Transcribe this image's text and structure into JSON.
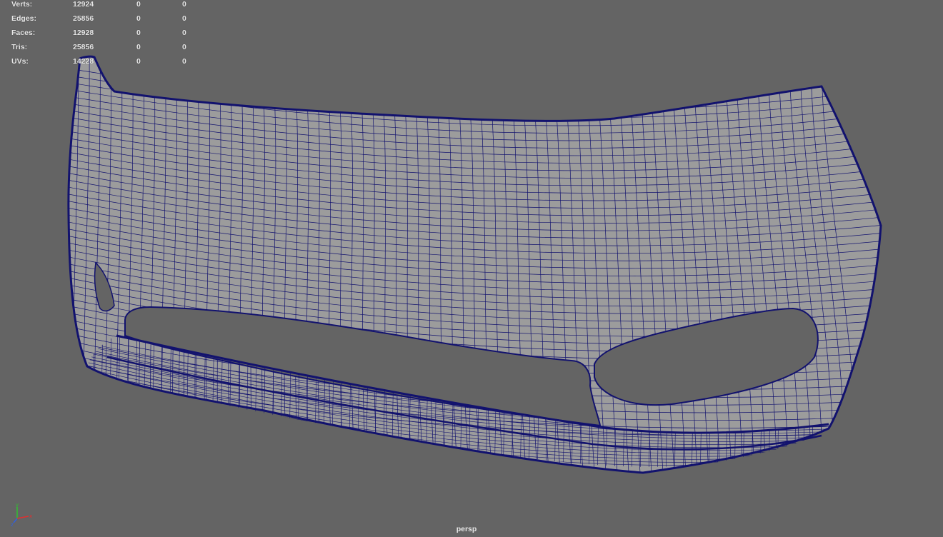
{
  "heads_up_display": {
    "rows": [
      {
        "label": "Verts:",
        "total": "12924",
        "selected": "0",
        "selected_component": "0"
      },
      {
        "label": "Edges:",
        "total": "25856",
        "selected": "0",
        "selected_component": "0"
      },
      {
        "label": "Faces:",
        "total": "12928",
        "selected": "0",
        "selected_component": "0"
      },
      {
        "label": "Tris:",
        "total": "25856",
        "selected": "0",
        "selected_component": "0"
      },
      {
        "label": "UVs:",
        "total": "14228",
        "selected": "0",
        "selected_component": "0"
      }
    ]
  },
  "viewport": {
    "camera_name": "persp",
    "background_color": "#646464",
    "mesh_fill_color": "#9c9c9c",
    "wireframe_color": "#12126e",
    "axis_icon": "xyz-axis-gizmo-icon",
    "axis_colors": {
      "x": "#e03030",
      "y": "#30c030",
      "z": "#3060e0"
    }
  }
}
